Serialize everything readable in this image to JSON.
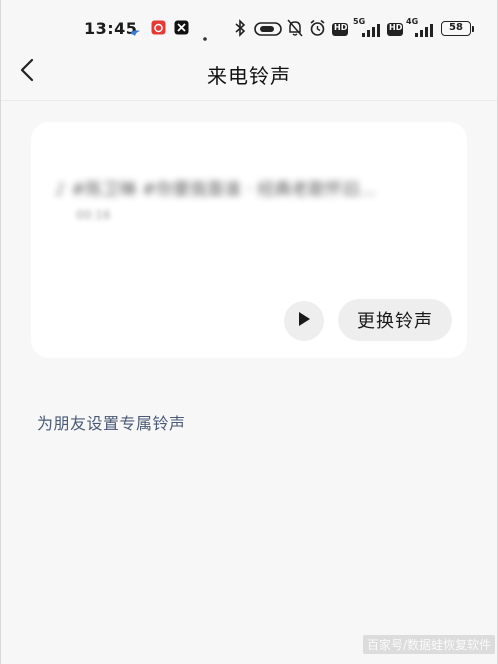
{
  "status_bar": {
    "time": "13:45",
    "network_5g": "5G",
    "network_4g": "4G",
    "hd_label": "HD",
    "battery": "58"
  },
  "header": {
    "title": "来电铃声",
    "back_icon": "chevron-left-icon"
  },
  "ringtone_card": {
    "title": "♪ #陈卫琳 #你要我靠谁 · 经典老歌怀旧...",
    "duration": "00:16",
    "play_icon": "play-icon",
    "change_button_label": "更换铃声"
  },
  "friend_link": "为朋友设置专属铃声",
  "watermark": "百家号/数据蛙恢复软件",
  "colors": {
    "background": "#f7f7f7",
    "card": "#ffffff",
    "button_bg": "#eeeeee",
    "link": "#4a5a75"
  }
}
